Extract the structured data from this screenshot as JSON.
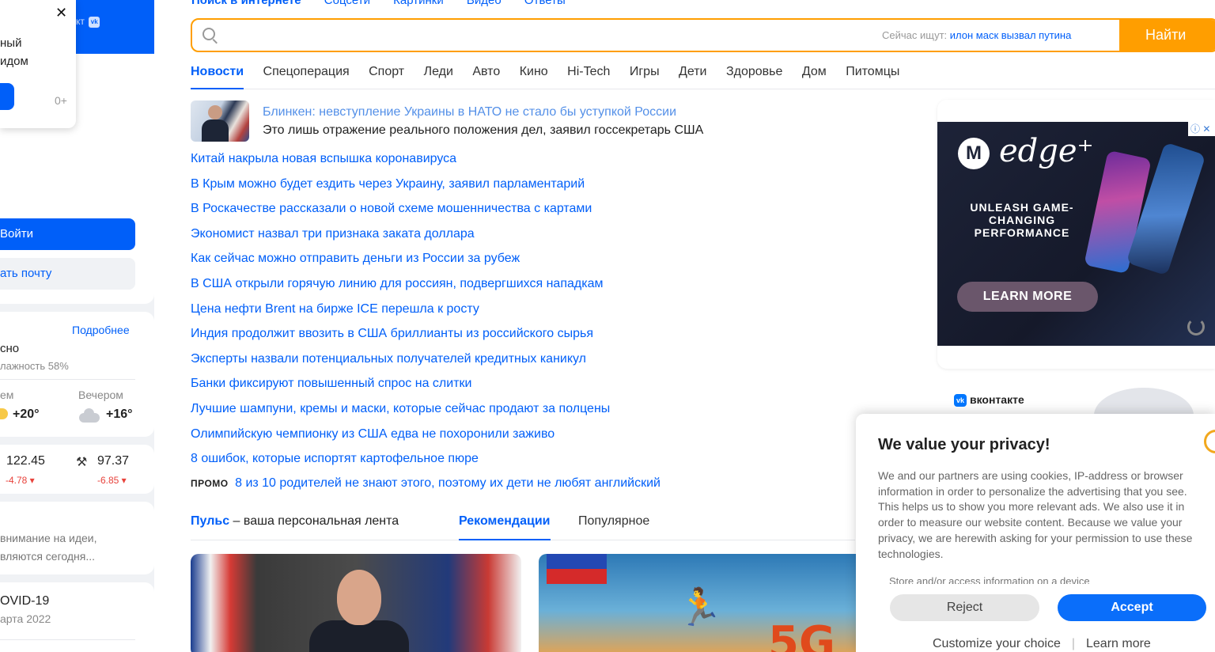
{
  "search": {
    "tabs": [
      "Поиск в интернете",
      "Соцсети",
      "Картинки",
      "Видео",
      "Ответы"
    ],
    "placeholder": "",
    "trending_label": "Сейчас ищут:",
    "trending_query": "илон маск вызвал путина",
    "submit_label": "Найти"
  },
  "categories": [
    "Новости",
    "Спецоперация",
    "Спорт",
    "Леди",
    "Авто",
    "Кино",
    "Hi-Tech",
    "Игры",
    "Дети",
    "Здоровье",
    "Дом",
    "Питомцы"
  ],
  "lead_news": {
    "title": "Блинкен: невступление Украины в НАТО не стало бы уступкой России",
    "subtitle": "Это лишь отражение реального положения дел, заявил госсекретарь США"
  },
  "news": [
    "Китай накрыла новая вспышка коронавируса",
    "В Крым можно будет ездить через Украину, заявил парламентарий",
    "В Роскачестве рассказали о новой схеме мошенничества с картами",
    "Экономист назвал три признака заката доллара",
    "Как сейчас можно отправить деньги из России за рубеж",
    "В США открыли горячую линию для россиян, подвергшихся нападкам",
    "Цена нефти Brent на бирже ICE перешла к росту",
    "Индия продолжит ввозить в США бриллианты из российского сырья",
    "Эксперты назвали потенциальных получателей кредитных каникул",
    "Банки фиксируют повышенный спрос на слитки",
    "Лучшие шампуни, кремы и маски, которые сейчас продают за полцены",
    "Олимпийскую чемпионку из США едва не похоронили заживо",
    "8 ошибок, которые испортят картофельное пюре"
  ],
  "promo": {
    "tag": "ПРОМО",
    "text": "8 из 10 родителей не знают этого, поэтому их дети не любят английский"
  },
  "feed": {
    "pulse_name": "Пульс",
    "pulse_desc": " – ваша персональная лента",
    "recommendations": "Рекомендации",
    "popular": "Популярное"
  },
  "sidebar": {
    "vk_text": "кт",
    "vk_icon": "vk",
    "popup_line1": "ный",
    "popup_line2": "идом",
    "popup_age": "0+",
    "popup_close": "✕",
    "login_label": "Войти",
    "create_label": "ать почту",
    "weather": {
      "more": "Подробнее",
      "condition": "сно",
      "humidity": "лажность 58%",
      "afternoon_label": "ем",
      "afternoon_temp": "+20°",
      "evening_label": "Вечером",
      "evening_temp": "+16°"
    },
    "rates": {
      "usd_value": "122.45",
      "usd_change": "-4.78 ▾",
      "oil_value": "97.37",
      "oil_change": "-6.85 ▾"
    },
    "ideas": {
      "line1": "внимание на идеи,",
      "line2": "вляются сегодня..."
    },
    "covid": {
      "title": "OVID-19",
      "date": "арта 2022"
    }
  },
  "ad": {
    "brand": "edge⁺",
    "tagline": "UNLEASH GAME-CHANGING PERFORMANCE",
    "cta": "LEARN MORE",
    "badge": "ⓘ ✕"
  },
  "vk_widget": {
    "label": "вконтакте"
  },
  "privacy": {
    "title": "We value your privacy!",
    "body": "We and our partners are using cookies, IP-address or browser information in order to personalize the advertising that you see. This helps us to show you more relevant ads. We also use it in order to measure our website content. Because we value your privacy, we are herewith asking for your permission to use these technologies.",
    "store": "Store and/or access information on a device",
    "reject": "Reject",
    "accept": "Accept",
    "customize": "Customize your choice",
    "separator": "|",
    "learn_more": "Learn more"
  },
  "colors": {
    "brand_blue": "#005ff9",
    "search_orange": "#ff9e00"
  }
}
